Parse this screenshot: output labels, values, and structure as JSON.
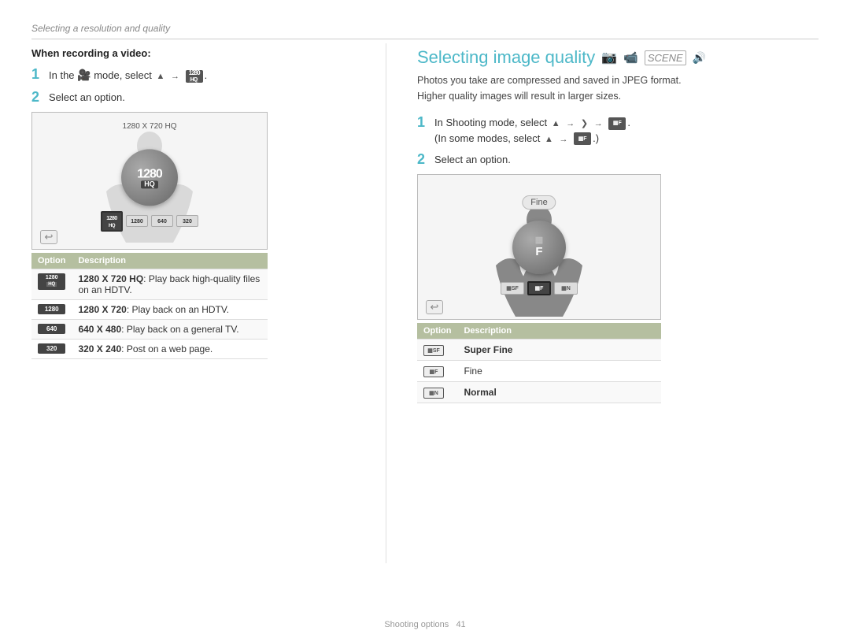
{
  "breadcrumb": "Selecting a resolution and quality",
  "left": {
    "when_recording": "When recording a video:",
    "step1_text": "In the",
    "step1_mode": "🎥",
    "step1_arrow": "→",
    "step1_badge": "1280 HQ",
    "step2_text": "Select an option.",
    "preview": {
      "label": "1280 X 720 HQ",
      "dial_main": "1280",
      "dial_sub": "HQ",
      "options": [
        "1280 HQ",
        "1280",
        "640",
        "320"
      ]
    },
    "table_header": [
      "Option",
      "Description"
    ],
    "table_rows": [
      {
        "option": "1280 HQ",
        "desc": "1280 X 720 HQ: Play back high-quality files on an HDTV."
      },
      {
        "option": "1280",
        "desc": "1280 X 720: Play back on an HDTV."
      },
      {
        "option": "640",
        "desc": "640 X 480: Play back on a general TV."
      },
      {
        "option": "320",
        "desc": "320 X 240: Post on a web page."
      }
    ]
  },
  "right": {
    "section_title": "Selecting image quality",
    "desc_line1": "Photos you take are compressed and saved in JPEG format.",
    "desc_line2": "Higher quality images will result in larger sizes.",
    "step1_text": "In Shooting mode, select",
    "step1_arrows": "→ → →",
    "step1_note": "(In some modes, select",
    "step1_note2": "→",
    "step1_badge": "quality",
    "step2_text": "Select an option.",
    "preview": {
      "fine_label": "Fine",
      "dial_letter": "F",
      "options": [
        "SF",
        "F",
        "N"
      ]
    },
    "table_header": [
      "Option",
      "Description"
    ],
    "table_rows": [
      {
        "option": "SF",
        "desc": "Super Fine"
      },
      {
        "option": "F",
        "desc": "Fine"
      },
      {
        "option": "N",
        "desc": "Normal"
      }
    ]
  },
  "footer": {
    "text": "Shooting options",
    "page": "41"
  }
}
